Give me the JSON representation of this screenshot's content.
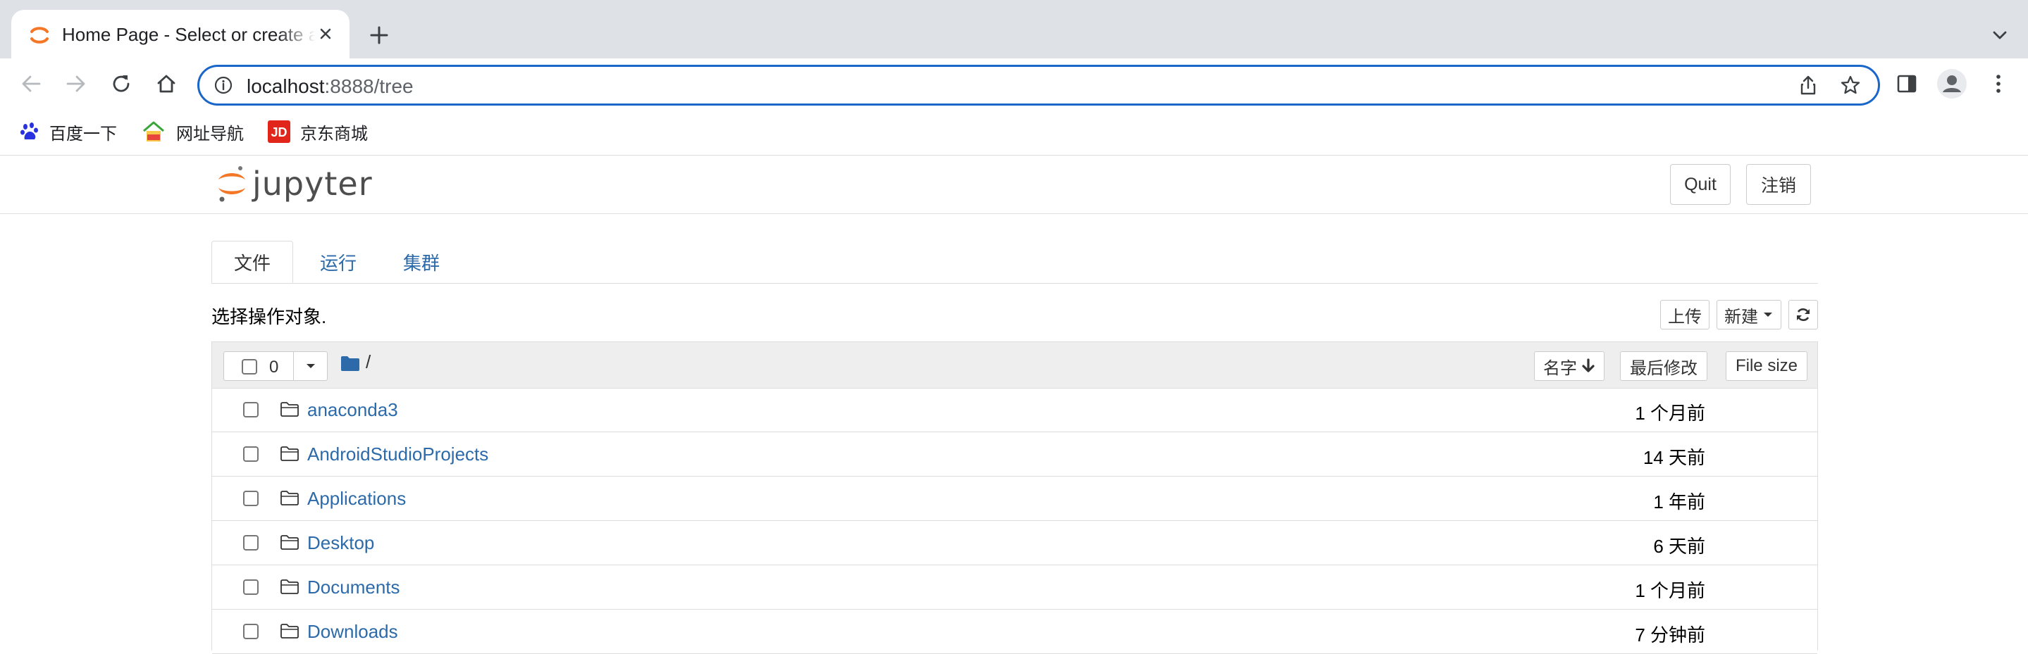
{
  "browser": {
    "tab_title": "Home Page - Select or create a notebook",
    "url_host": "localhost",
    "url_rest": ":8888/tree",
    "bookmarks": [
      {
        "label": "百度一下",
        "icon": "baidu-paw-icon"
      },
      {
        "label": "网址导航",
        "icon": "2345-house-icon"
      },
      {
        "label": "京东商城",
        "icon": "jd-logo-icon"
      }
    ]
  },
  "jupyter": {
    "logo_text": "jupyter",
    "quit_label": "Quit",
    "logout_label": "注销",
    "tabs": [
      {
        "label": "文件",
        "active": true
      },
      {
        "label": "运行",
        "active": false
      },
      {
        "label": "集群",
        "active": false
      }
    ],
    "select_hint": "选择操作对象.",
    "upload_label": "上传",
    "new_label": "新建",
    "selected_count": "0",
    "breadcrumb": "/",
    "sort_name_label": "名字",
    "last_modified_label": "最后修改",
    "file_size_label": "File size",
    "rows": [
      {
        "name": "anaconda3",
        "modified": "1 个月前"
      },
      {
        "name": "AndroidStudioProjects",
        "modified": "14 天前"
      },
      {
        "name": "Applications",
        "modified": "1 年前"
      },
      {
        "name": "Desktop",
        "modified": "6 天前"
      },
      {
        "name": "Documents",
        "modified": "1 个月前"
      },
      {
        "name": "Downloads",
        "modified": "7 分钟前"
      }
    ]
  },
  "colors": {
    "accent": "#1a66c9",
    "link": "#2c6aa9",
    "jupyter_orange": "#f37726",
    "tabstrip": "#dee1e6"
  }
}
